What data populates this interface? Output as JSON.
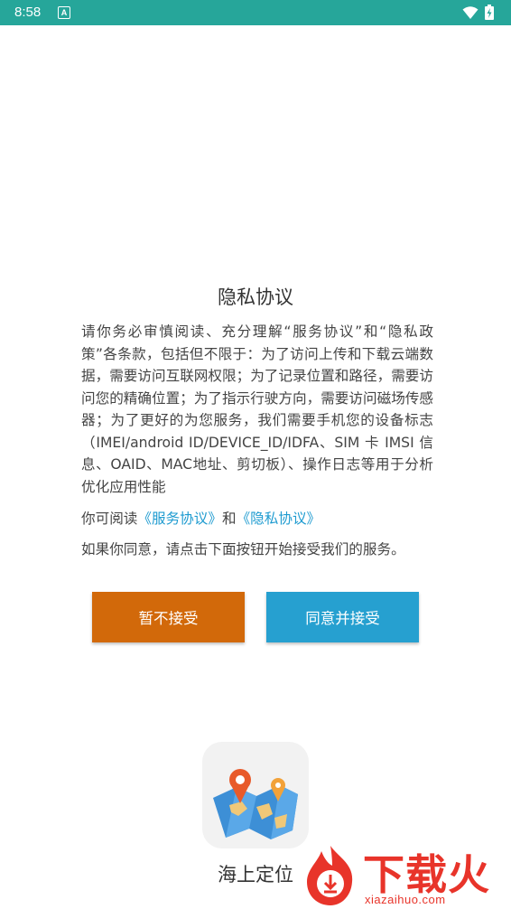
{
  "status_bar": {
    "time": "8:58",
    "notification_icon": "A",
    "wifi_icon": "wifi-icon",
    "battery_icon": "battery-charging-icon",
    "bg_color": "#26a69a"
  },
  "dialog": {
    "title": "隐私协议",
    "body": "请你务必审慎阅读、充分理解“服务协议”和“隐私政策”各条款，包括但不限于：为了访问上传和下载云端数据，需要访问互联网权限；为了记录位置和路径，需要访问您的精确位置；为了指示行驶方向，需要访问磁场传感器；为了更好的为您服务，我们需要手机您的设备标志（IMEI/android ID/DEVICE_ID/IDFA、SIM 卡 IMSI 信息、OAID、MAC地址、剪切板）、操作日志等用于分析优化应用性能",
    "read_prefix": "你可阅读",
    "service_link": "《服务协议》",
    "and_text": "和",
    "privacy_link": "《隐私协议》",
    "agree_text": "如果你同意，请点击下面按钮开始接受我们的服务。",
    "decline_button": "暂不接受",
    "accept_button": "同意并接受",
    "link_color": "#1e9bd0",
    "decline_color": "#d2690a",
    "accept_color": "#26a0d0"
  },
  "app": {
    "name": "海上定位",
    "icon": "map-pin-icon"
  },
  "watermark": {
    "text": "下载火",
    "url": "xiazaihuo.com",
    "color": "#e8342a"
  }
}
